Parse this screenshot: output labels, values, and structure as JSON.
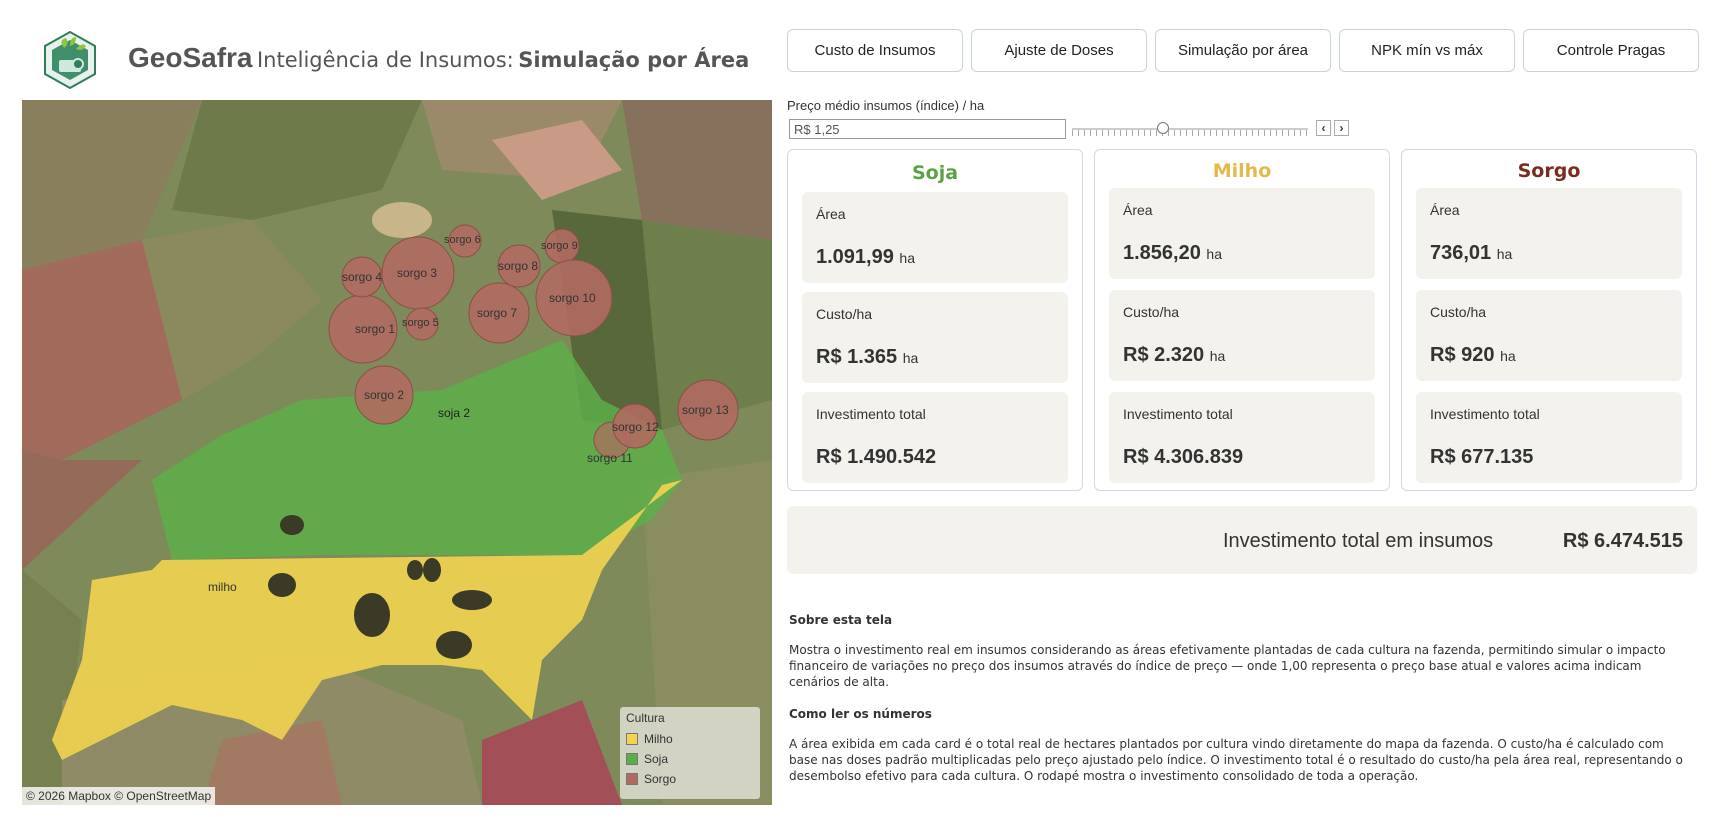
{
  "header": {
    "brand": "GeoSafra",
    "subtitle": "Inteligência de Insumos:",
    "page_title": "Simulação por Área"
  },
  "nav": [
    {
      "label": "Custo de Insumos"
    },
    {
      "label": "Ajuste de Doses"
    },
    {
      "label": "Simulação por área"
    },
    {
      "label": "NPK mín vs máx"
    },
    {
      "label": "Controle Pragas"
    }
  ],
  "price": {
    "label": "Preço médio insumos (índice) / ha",
    "value": "R$ 1,25",
    "slider_fraction": 0.38,
    "prev_icon": "chevron-left-icon",
    "next_icon": "chevron-right-icon"
  },
  "crops": [
    {
      "name": "Soja",
      "color": "#5aa344",
      "area_label": "Área",
      "area": "1.091,99",
      "area_unit": "ha",
      "cost_label": "Custo/ha",
      "cost": "R$ 1.365",
      "cost_unit": "ha",
      "invest_label": "Investimento total",
      "invest": "R$ 1.490.542"
    },
    {
      "name": "Milho",
      "color": "#e3b94a",
      "area_label": "Área",
      "area": "1.856,20",
      "area_unit": "ha",
      "cost_label": "Custo/ha",
      "cost": "R$ 2.320",
      "cost_unit": "ha",
      "invest_label": "Investimento total",
      "invest": "R$ 4.306.839"
    },
    {
      "name": "Sorgo",
      "color": "#7b2c1f",
      "area_label": "Área",
      "area": "736,01",
      "area_unit": "ha",
      "cost_label": "Custo/ha",
      "cost": "R$ 920",
      "cost_unit": "ha",
      "invest_label": "Investimento total",
      "invest": "R$ 677.135"
    }
  ],
  "total": {
    "label": "Investimento total em insumos",
    "value": "R$ 6.474.515"
  },
  "about": {
    "title1": "Sobre esta tela",
    "text1": "Mostra o investimento real em insumos considerando as áreas efetivamente plantadas de cada cultura na fazenda, permitindo simular o impacto financeiro de variações no preço dos insumos através do índice de preço — onde 1,00 representa o preço base atual e valores acima indicam cenários de alta.",
    "title2": "Como ler os números",
    "text2": "A área exibida em cada card é o total real de hectares plantados por cultura vindo diretamente do mapa da fazenda. O custo/ha é calculado com base nas doses padrão multiplicadas pelo preço ajustado pelo índice. O investimento total é o resultado do custo/ha pela área real, representando o desembolso efetivo para cada cultura. O rodapé mostra o investimento consolidado de toda a operação."
  },
  "map": {
    "fields": {
      "milho": "milho",
      "soja": "soja 2"
    },
    "sorgo_labels": [
      "sorgo 1",
      "sorgo 2",
      "sorgo 3",
      "sorgo 4",
      "sorgo 5",
      "sorgo 6",
      "sorgo 7",
      "sorgo 8",
      "sorgo 9",
      "sorgo 10",
      "sorgo 11",
      "sorgo 12",
      "sorgo 13"
    ],
    "legend": {
      "title": "Cultura",
      "items": [
        {
          "label": "Milho",
          "color": "#f2d34f"
        },
        {
          "label": "Soja",
          "color": "#5dae4a"
        },
        {
          "label": "Sorgo",
          "color": "#b06a60"
        }
      ]
    },
    "attribution": "© 2026 Mapbox © OpenStreetMap"
  }
}
